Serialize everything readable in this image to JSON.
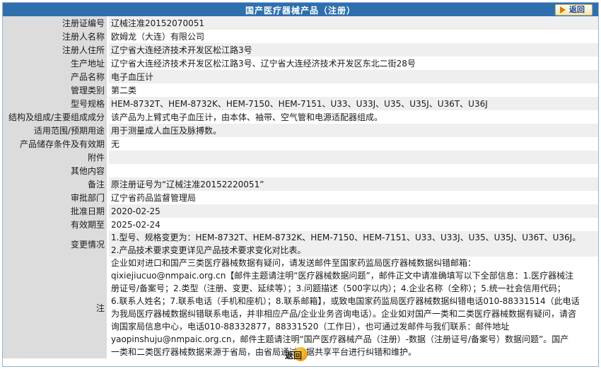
{
  "header": {
    "title": "国产医疗器械产品（注册）",
    "back_label": "返回"
  },
  "fields": [
    {
      "label": "注册证编号",
      "value": "辽械注准20152070051"
    },
    {
      "label": "注册人名称",
      "value": "欧姆龙（大连）有限公司"
    },
    {
      "label": "注册人住所",
      "value": "辽宁省大连经济技术开发区松江路3号"
    },
    {
      "label": "生产地址",
      "value": "辽宁省大连经济技术开发区松江路3号、辽宁省大连经济技术开发区东北二街28号"
    },
    {
      "label": "产品名称",
      "value": "电子血压计"
    },
    {
      "label": "管理类别",
      "value": "第二类"
    },
    {
      "label": "型号规格",
      "value": "HEM-8732T、HEM-8732K、HEM-7150、HEM-7151、U33、U33J、U35、U35J、U36T、U36J"
    },
    {
      "label": "结构及组成/主要组成成分",
      "value": "该产品为上臂式电子血压计，由本体、袖带、空气管和电源适配器组成。"
    },
    {
      "label": "适用范围/预期用途",
      "value": "用于测量成人血压及脉搏数。"
    },
    {
      "label": "产品储存条件及有效期",
      "value": "无"
    },
    {
      "label": "附件",
      "value": ""
    },
    {
      "label": "其他内容",
      "value": ""
    },
    {
      "label": "备注",
      "value": "原注册证号为“辽械注准20152220051”"
    },
    {
      "label": "审批部门",
      "value": "辽宁省药品监督管理局"
    },
    {
      "label": "批准日期",
      "value": "2020-02-25"
    },
    {
      "label": "有效期至",
      "value": "2025-02-24"
    }
  ],
  "changes": {
    "label": "变更情况",
    "lines": [
      "1.型号、规格变更为：HEM-8732T、HEM-8732K、HEM-7150、HEM-7151、U33、U33J、U35、U35J、U36T、U36J。",
      "2.产品技术要求变更详见产品技术要求变化对比表。"
    ]
  },
  "note": {
    "label": "注",
    "lines": [
      "企业如对进口和国产三类医疗器械数据有疑问，请发送邮件至国家药监局医疗器械数据纠错邮箱：",
      "qixiejiucuo@nmpaic.org.cn【邮件主题请注明“医疗器械数据问题”，邮件正文中请准确填写以下全部信息：1.医疗器械注",
      "册证号/备案号；2.类型（注册、变更、延续等）；3.问题描述（500字以内）；4.企业名称（全称）；5.统一社会信用代码；",
      "6.联系人姓名；7.联系电话（手机和座机）；8.联系邮箱】，或致电国家药监局医疗器械数据纠错电话010-88331514（此电话",
      "为我局医疗器械数据纠错联系电话，并非相应产品/企业业务咨询电话）。企业如对国产一类和二类医疗器械数据有疑问，请咨",
      "询国家局信息中心，电话010-88332877，88331520（工作日），也可通过发邮件与我们联系：邮件地址",
      "yaopinshuju@nmpaic.org.cn，邮件主题请注明“国产医疗器械产品（注册）-数据（注册证号/备案号）数据问题”。国产",
      "一类和二类医疗器械数据来源于省局，由省局通过数据共享平台进行纠错和维护。"
    ]
  },
  "footer": {
    "back_label": "返回"
  }
}
